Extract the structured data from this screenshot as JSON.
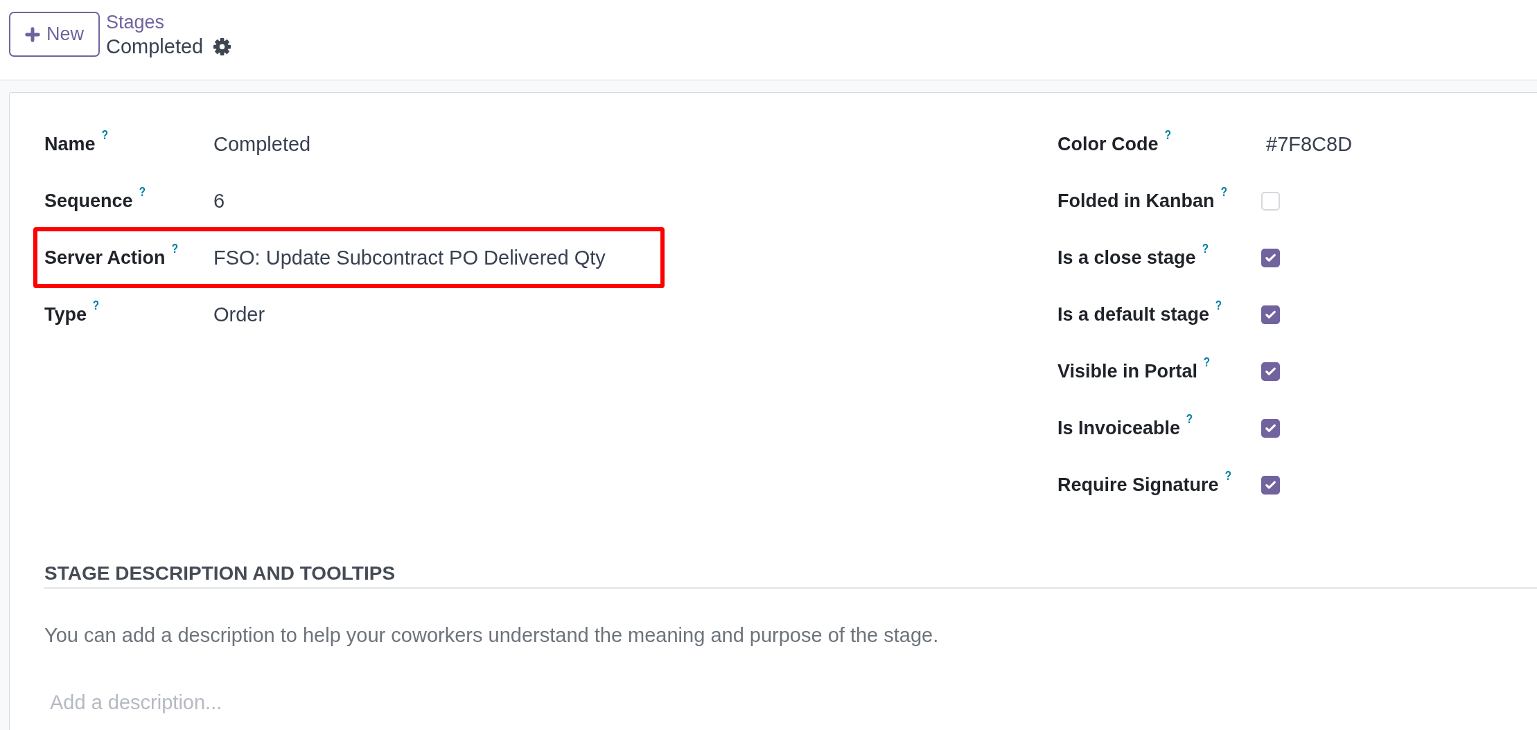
{
  "header": {
    "new_button": {
      "label": "New"
    },
    "breadcrumb": {
      "parent": "Stages",
      "current": "Completed"
    }
  },
  "form": {
    "left_fields": [
      {
        "label": "Name",
        "help": "?",
        "value": "Completed",
        "highlighted": false
      },
      {
        "label": "Sequence",
        "help": "?",
        "value": "6",
        "highlighted": false
      },
      {
        "label": "Server Action",
        "help": "?",
        "value": "FSO: Update Subcontract PO Delivered Qty",
        "highlighted": true
      },
      {
        "label": "Type",
        "help": "?",
        "value": "Order",
        "highlighted": false
      }
    ],
    "right_fields": [
      {
        "kind": "text",
        "label": "Color Code",
        "help": "?",
        "value": "#7F8C8D"
      },
      {
        "kind": "checkbox",
        "label": "Folded in Kanban",
        "help": "?",
        "checked": false
      },
      {
        "kind": "checkbox",
        "label": "Is a close stage",
        "help": "?",
        "checked": true
      },
      {
        "kind": "checkbox",
        "label": "Is a default stage",
        "help": "?",
        "checked": true
      },
      {
        "kind": "checkbox",
        "label": "Visible in Portal",
        "help": "?",
        "checked": true
      },
      {
        "kind": "checkbox",
        "label": "Is Invoiceable",
        "help": "?",
        "checked": true
      },
      {
        "kind": "checkbox",
        "label": "Require Signature",
        "help": "?",
        "checked": true
      }
    ]
  },
  "section": {
    "title": "STAGE DESCRIPTION AND TOOLTIPS",
    "hint": "You can add a description to help your coworkers understand the meaning and purpose of the stage.",
    "description": {
      "placeholder": "Add a description..."
    }
  }
}
